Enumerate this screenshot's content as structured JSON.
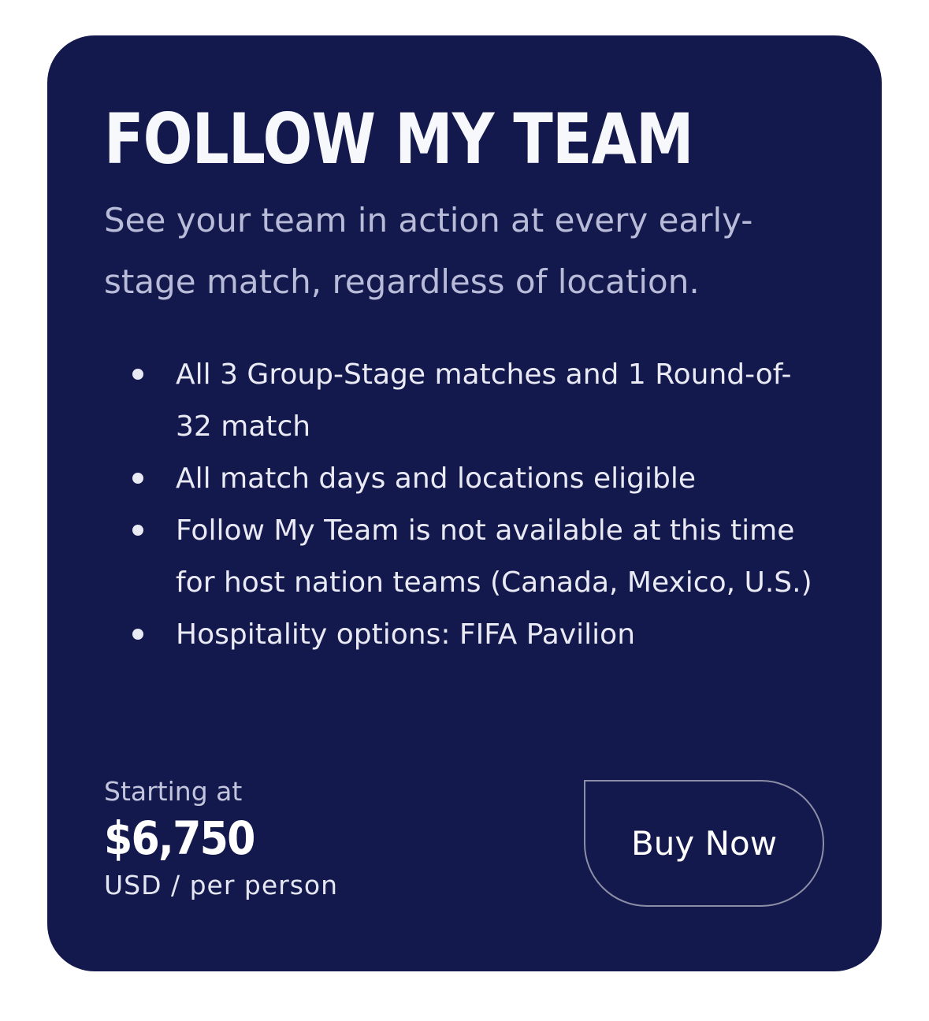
{
  "card": {
    "title": "FOLLOW MY TEAM",
    "subtitle": "See your team in action at every early-stage match, regardless of location.",
    "features": [
      "All 3 Group-Stage matches and 1 Round-of-32 match",
      "All match days and locations eligible",
      "Follow My Team is not available at this time for host nation teams (Canada, Mexico, U.S.)",
      "Hospitality options: FIFA Pavilion"
    ],
    "pricing": {
      "starting_label": "Starting at",
      "price": "$6,750",
      "unit": "USD / per person"
    },
    "buy_button_label": "Buy Now"
  },
  "colors": {
    "page_background": "#ffffff",
    "card_background": "#14194d",
    "title_text": "#f7f8fc",
    "subtitle_text": "#b9bcd8",
    "body_text": "#e9eaf4",
    "button_border": "#8b8ea6"
  }
}
